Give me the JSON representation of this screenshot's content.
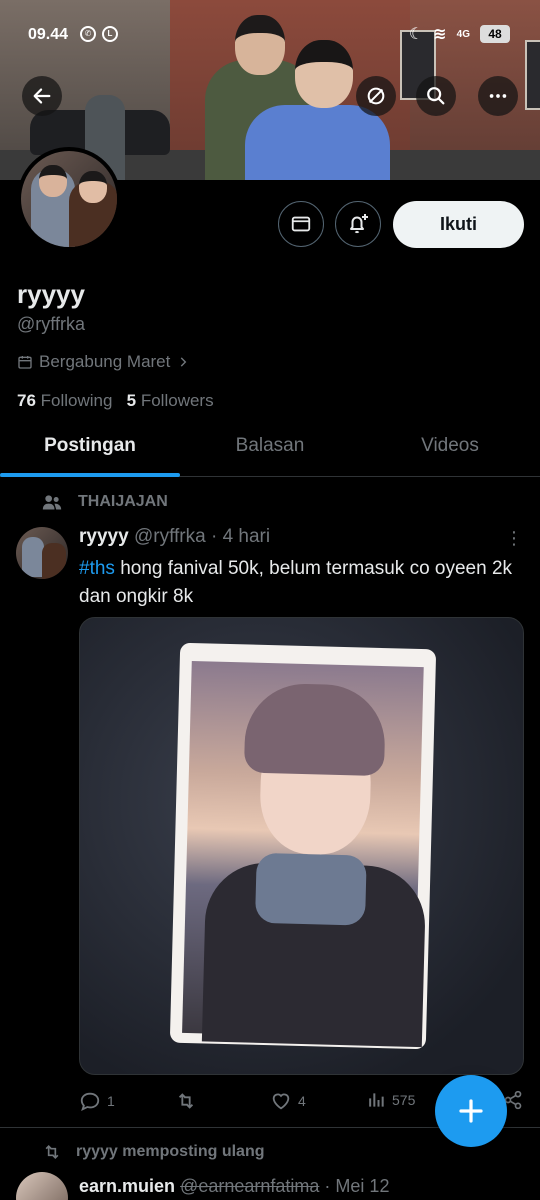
{
  "status_bar": {
    "time": "09.44",
    "battery": "48",
    "network": "4G"
  },
  "profile": {
    "name": "ryyyy",
    "handle": "@ryffrka",
    "joined": "Bergabung Maret",
    "following_count": "76",
    "following_label": "Following",
    "followers_count": "5",
    "followers_label": "Followers",
    "follow_button": "Ikuti"
  },
  "tabs": [
    {
      "label": "Postingan",
      "active": true
    },
    {
      "label": "Balasan",
      "active": false
    },
    {
      "label": "Videos",
      "active": false
    }
  ],
  "post": {
    "community": "THAIJAJAN",
    "author_name": "ryyyy",
    "author_handle": "@ryffrka",
    "time": "4 hari",
    "hashtag": "#ths",
    "text": " hong fanival 50k, belum termasuk co oyeen 2k dan ongkir 8k",
    "replies": "1",
    "likes": "4",
    "views": "575"
  },
  "repost": {
    "label": "ryyyy memposting ulang",
    "author_name": "earn.muien",
    "author_handle": "@earnearnfatima",
    "time": "Mei 12"
  },
  "colors": {
    "accent": "#1d9bf0",
    "background": "#000000",
    "muted": "#71767b"
  },
  "icons": [
    "back-icon",
    "no-signal-icon",
    "search-icon",
    "more-icon",
    "mail-icon",
    "bell-plus-icon",
    "calendar-icon",
    "chevron-right-icon",
    "people-icon",
    "reply-icon",
    "retweet-icon",
    "heart-icon",
    "views-icon",
    "share-icon",
    "plus-icon"
  ]
}
